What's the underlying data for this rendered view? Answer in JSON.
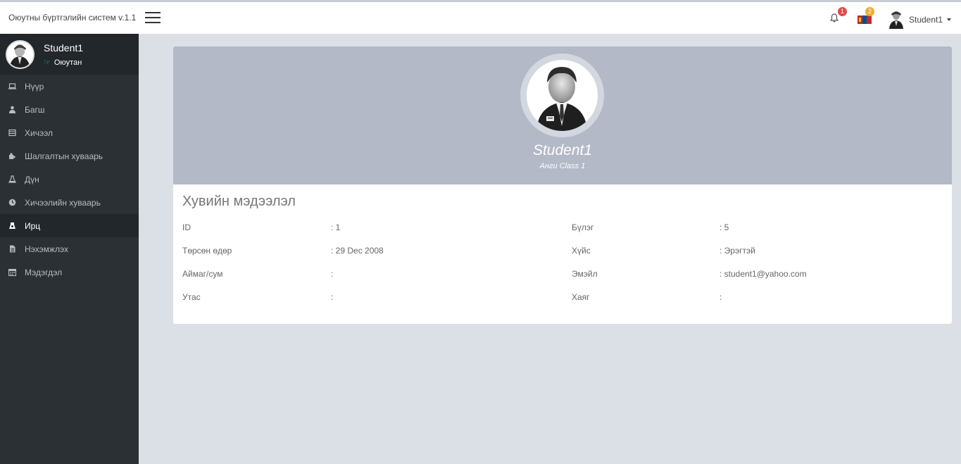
{
  "app": {
    "brand": "Оюутны бүртгэлийн систем v.1.1"
  },
  "header": {
    "notifications_count": "1",
    "language_count": "2",
    "user_name": "Student1",
    "icons": [
      "menu-icon",
      "bell-icon",
      "mongolia-flag-icon",
      "user-avatar-icon",
      "caret-down-icon"
    ]
  },
  "sidebar": {
    "user_name": "Student1",
    "user_role": "Оюутан",
    "items": [
      {
        "label": "Нүүр",
        "icon": "laptop-icon"
      },
      {
        "label": "Багш",
        "icon": "user-icon"
      },
      {
        "label": "Хичээл",
        "icon": "book-icon"
      },
      {
        "label": "Шалгалтын хуваарь",
        "icon": "puzzle-icon"
      },
      {
        "label": "Дүн",
        "icon": "flask-icon"
      },
      {
        "label": "Хичээлийн хуваарь",
        "icon": "clock-icon"
      },
      {
        "label": "Ирц",
        "icon": "checklist-icon"
      },
      {
        "label": "Нэхэмжлэх",
        "icon": "file-icon"
      },
      {
        "label": "Мэдэгдэл",
        "icon": "calendar-icon"
      }
    ],
    "active_index": 6
  },
  "profile": {
    "name": "Student1",
    "class_label": "Анги Class 1",
    "section_title": "Хувийн мэдээлэл",
    "fields_left": [
      {
        "label": "ID",
        "value": ": 1"
      },
      {
        "label": "Төрсөн өдөр",
        "value": ": 29 Dec 2008"
      },
      {
        "label": "Аймаг/сум",
        "value": ":"
      },
      {
        "label": "Утас",
        "value": ":"
      }
    ],
    "fields_right": [
      {
        "label": "Бүлэг",
        "value": ": 5"
      },
      {
        "label": "Хүйс",
        "value": ": Эрэгтэй"
      },
      {
        "label": "Эмэйл",
        "value": ": student1@yahoo.com"
      },
      {
        "label": "Хаяг",
        "value": ":"
      }
    ]
  },
  "colors": {
    "sidebar_bg": "#2b3034",
    "sidebar_active": "#22272b",
    "card_header": "#b3b9c6",
    "page_bg": "#dbe0e7",
    "badge_red": "#e14b4b",
    "badge_orange": "#f0ad32"
  }
}
